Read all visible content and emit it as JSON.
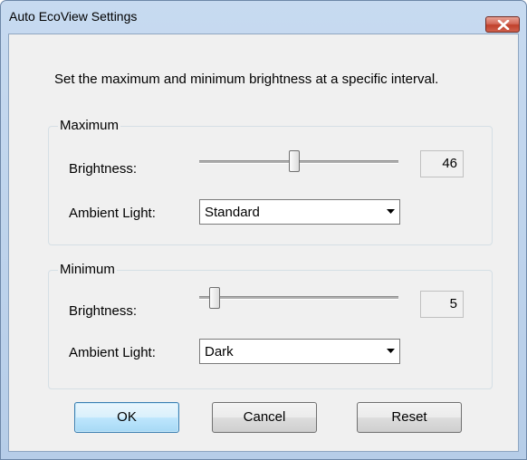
{
  "window": {
    "title": "Auto EcoView Settings"
  },
  "description": "Set the maximum and minimum brightness at a specific interval.",
  "maximum": {
    "legend": "Maximum",
    "brightness_label": "Brightness:",
    "brightness_value": "46",
    "brightness_level": 46,
    "ambient_label": "Ambient Light:",
    "ambient_value": "Standard"
  },
  "minimum": {
    "legend": "Minimum",
    "brightness_label": "Brightness:",
    "brightness_value": "5",
    "brightness_level": 5,
    "ambient_label": "Ambient Light:",
    "ambient_value": "Dark"
  },
  "buttons": {
    "ok": "OK",
    "cancel": "Cancel",
    "reset": "Reset"
  },
  "icons": {
    "close": "close-icon",
    "dropdown": "chevron-down-icon"
  }
}
